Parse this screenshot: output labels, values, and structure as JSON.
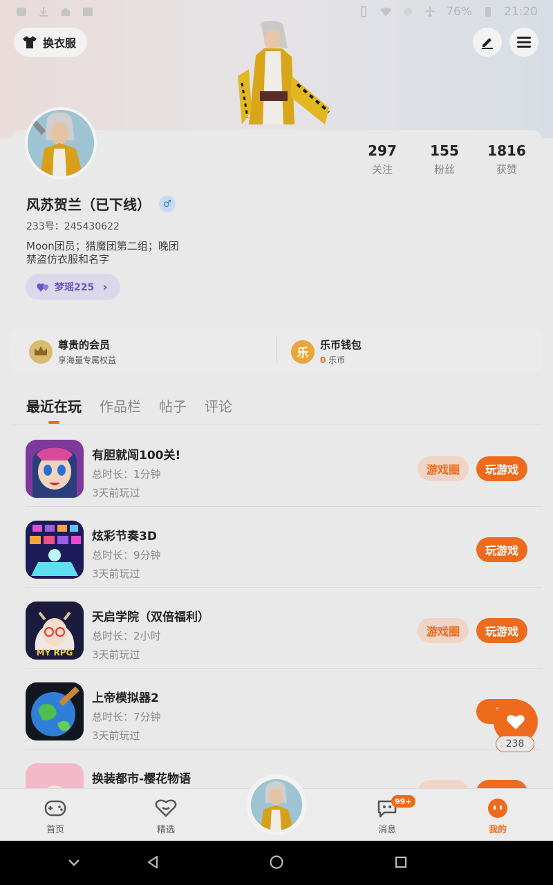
{
  "status_bar": {
    "battery": "76%",
    "time": "21:20"
  },
  "header": {
    "outfit_button": "换衣服"
  },
  "profile": {
    "stats": [
      {
        "value": "297",
        "label": "关注"
      },
      {
        "value": "155",
        "label": "粉丝"
      },
      {
        "value": "1816",
        "label": "获赞"
      }
    ],
    "name": "风苏贺兰（已下线）",
    "gender_symbol": "♂",
    "uid": "233号：245430622",
    "bio_line1": "Moon团员；猎魔团第二组；晚团",
    "bio_line2": "禁盗仿衣服和名字",
    "tag": "梦瑶225",
    "tag_chevron": "›"
  },
  "vip": {
    "member_title": "尊贵的会员",
    "member_sub": "享海量专属权益",
    "wallet_title": "乐币钱包",
    "wallet_amount": "0",
    "wallet_unit": "乐币",
    "wallet_icon_text": "乐"
  },
  "tabs": [
    "最近在玩",
    "作品栏",
    "帖子",
    "评论"
  ],
  "games": [
    {
      "title": "有胆就闯100关!",
      "duration": "总时长：1分钟",
      "last": "3天前玩过",
      "circle": "游戏圈",
      "play": "玩游戏"
    },
    {
      "title": "炫彩节奏3D",
      "duration": "总时长：9分钟",
      "last": "3天前玩过",
      "play": "玩游戏"
    },
    {
      "title": "天启学院（双倍福利）",
      "duration": "总时长：2小时",
      "last": "3天前玩过",
      "circle": "游戏圈",
      "play": "玩游戏"
    },
    {
      "title": "上帝模拟器2",
      "duration": "总时长：7分钟",
      "last": "3天前玩过",
      "play": "玩"
    },
    {
      "title": "换装都市-樱花物语",
      "duration": "",
      "last": "",
      "circle": "",
      "play": ""
    }
  ],
  "game_icon_text": {
    "g3": "MY RPG"
  },
  "float_like": {
    "count": "238"
  },
  "nav": {
    "home": "首页",
    "featured": "精选",
    "messages": "消息",
    "messages_badge": "99+",
    "mine": "我的"
  },
  "colors": {
    "accent": "#ee6a1c"
  }
}
